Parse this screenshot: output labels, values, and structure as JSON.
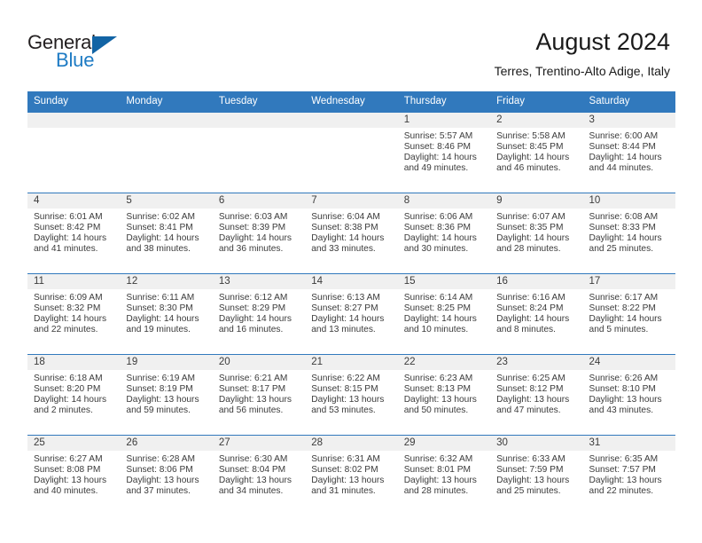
{
  "brand": {
    "name_part1": "General",
    "name_part2": "Blue",
    "logo_icon": "triangle-icon",
    "accent_color": "#1e7bc4"
  },
  "header": {
    "title": "August 2024",
    "subtitle": "Terres, Trentino-Alto Adige, Italy"
  },
  "calendar": {
    "header_color": "#3179bd",
    "weekday_headers": [
      "Sunday",
      "Monday",
      "Tuesday",
      "Wednesday",
      "Thursday",
      "Friday",
      "Saturday"
    ],
    "weeks": [
      [
        {
          "day": "",
          "lines": []
        },
        {
          "day": "",
          "lines": []
        },
        {
          "day": "",
          "lines": []
        },
        {
          "day": "",
          "lines": []
        },
        {
          "day": "1",
          "lines": [
            "Sunrise: 5:57 AM",
            "Sunset: 8:46 PM",
            "Daylight: 14 hours",
            "and 49 minutes."
          ]
        },
        {
          "day": "2",
          "lines": [
            "Sunrise: 5:58 AM",
            "Sunset: 8:45 PM",
            "Daylight: 14 hours",
            "and 46 minutes."
          ]
        },
        {
          "day": "3",
          "lines": [
            "Sunrise: 6:00 AM",
            "Sunset: 8:44 PM",
            "Daylight: 14 hours",
            "and 44 minutes."
          ]
        }
      ],
      [
        {
          "day": "4",
          "lines": [
            "Sunrise: 6:01 AM",
            "Sunset: 8:42 PM",
            "Daylight: 14 hours",
            "and 41 minutes."
          ]
        },
        {
          "day": "5",
          "lines": [
            "Sunrise: 6:02 AM",
            "Sunset: 8:41 PM",
            "Daylight: 14 hours",
            "and 38 minutes."
          ]
        },
        {
          "day": "6",
          "lines": [
            "Sunrise: 6:03 AM",
            "Sunset: 8:39 PM",
            "Daylight: 14 hours",
            "and 36 minutes."
          ]
        },
        {
          "day": "7",
          "lines": [
            "Sunrise: 6:04 AM",
            "Sunset: 8:38 PM",
            "Daylight: 14 hours",
            "and 33 minutes."
          ]
        },
        {
          "day": "8",
          "lines": [
            "Sunrise: 6:06 AM",
            "Sunset: 8:36 PM",
            "Daylight: 14 hours",
            "and 30 minutes."
          ]
        },
        {
          "day": "9",
          "lines": [
            "Sunrise: 6:07 AM",
            "Sunset: 8:35 PM",
            "Daylight: 14 hours",
            "and 28 minutes."
          ]
        },
        {
          "day": "10",
          "lines": [
            "Sunrise: 6:08 AM",
            "Sunset: 8:33 PM",
            "Daylight: 14 hours",
            "and 25 minutes."
          ]
        }
      ],
      [
        {
          "day": "11",
          "lines": [
            "Sunrise: 6:09 AM",
            "Sunset: 8:32 PM",
            "Daylight: 14 hours",
            "and 22 minutes."
          ]
        },
        {
          "day": "12",
          "lines": [
            "Sunrise: 6:11 AM",
            "Sunset: 8:30 PM",
            "Daylight: 14 hours",
            "and 19 minutes."
          ]
        },
        {
          "day": "13",
          "lines": [
            "Sunrise: 6:12 AM",
            "Sunset: 8:29 PM",
            "Daylight: 14 hours",
            "and 16 minutes."
          ]
        },
        {
          "day": "14",
          "lines": [
            "Sunrise: 6:13 AM",
            "Sunset: 8:27 PM",
            "Daylight: 14 hours",
            "and 13 minutes."
          ]
        },
        {
          "day": "15",
          "lines": [
            "Sunrise: 6:14 AM",
            "Sunset: 8:25 PM",
            "Daylight: 14 hours",
            "and 10 minutes."
          ]
        },
        {
          "day": "16",
          "lines": [
            "Sunrise: 6:16 AM",
            "Sunset: 8:24 PM",
            "Daylight: 14 hours",
            "and 8 minutes."
          ]
        },
        {
          "day": "17",
          "lines": [
            "Sunrise: 6:17 AM",
            "Sunset: 8:22 PM",
            "Daylight: 14 hours",
            "and 5 minutes."
          ]
        }
      ],
      [
        {
          "day": "18",
          "lines": [
            "Sunrise: 6:18 AM",
            "Sunset: 8:20 PM",
            "Daylight: 14 hours",
            "and 2 minutes."
          ]
        },
        {
          "day": "19",
          "lines": [
            "Sunrise: 6:19 AM",
            "Sunset: 8:19 PM",
            "Daylight: 13 hours",
            "and 59 minutes."
          ]
        },
        {
          "day": "20",
          "lines": [
            "Sunrise: 6:21 AM",
            "Sunset: 8:17 PM",
            "Daylight: 13 hours",
            "and 56 minutes."
          ]
        },
        {
          "day": "21",
          "lines": [
            "Sunrise: 6:22 AM",
            "Sunset: 8:15 PM",
            "Daylight: 13 hours",
            "and 53 minutes."
          ]
        },
        {
          "day": "22",
          "lines": [
            "Sunrise: 6:23 AM",
            "Sunset: 8:13 PM",
            "Daylight: 13 hours",
            "and 50 minutes."
          ]
        },
        {
          "day": "23",
          "lines": [
            "Sunrise: 6:25 AM",
            "Sunset: 8:12 PM",
            "Daylight: 13 hours",
            "and 47 minutes."
          ]
        },
        {
          "day": "24",
          "lines": [
            "Sunrise: 6:26 AM",
            "Sunset: 8:10 PM",
            "Daylight: 13 hours",
            "and 43 minutes."
          ]
        }
      ],
      [
        {
          "day": "25",
          "lines": [
            "Sunrise: 6:27 AM",
            "Sunset: 8:08 PM",
            "Daylight: 13 hours",
            "and 40 minutes."
          ]
        },
        {
          "day": "26",
          "lines": [
            "Sunrise: 6:28 AM",
            "Sunset: 8:06 PM",
            "Daylight: 13 hours",
            "and 37 minutes."
          ]
        },
        {
          "day": "27",
          "lines": [
            "Sunrise: 6:30 AM",
            "Sunset: 8:04 PM",
            "Daylight: 13 hours",
            "and 34 minutes."
          ]
        },
        {
          "day": "28",
          "lines": [
            "Sunrise: 6:31 AM",
            "Sunset: 8:02 PM",
            "Daylight: 13 hours",
            "and 31 minutes."
          ]
        },
        {
          "day": "29",
          "lines": [
            "Sunrise: 6:32 AM",
            "Sunset: 8:01 PM",
            "Daylight: 13 hours",
            "and 28 minutes."
          ]
        },
        {
          "day": "30",
          "lines": [
            "Sunrise: 6:33 AM",
            "Sunset: 7:59 PM",
            "Daylight: 13 hours",
            "and 25 minutes."
          ]
        },
        {
          "day": "31",
          "lines": [
            "Sunrise: 6:35 AM",
            "Sunset: 7:57 PM",
            "Daylight: 13 hours",
            "and 22 minutes."
          ]
        }
      ]
    ]
  }
}
